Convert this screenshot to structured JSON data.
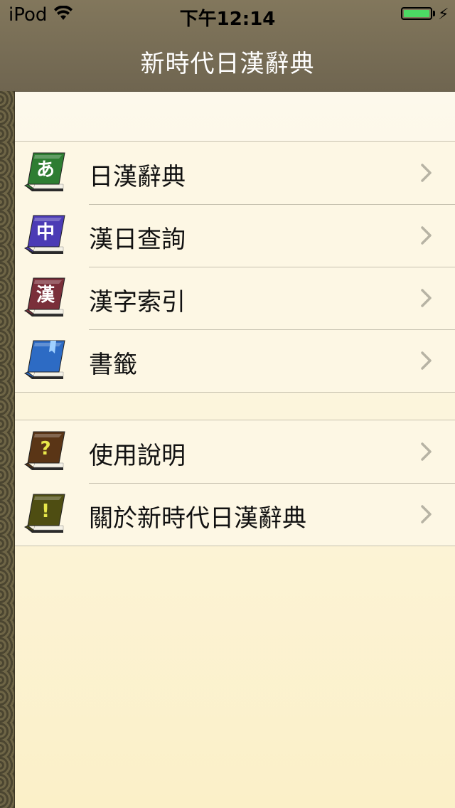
{
  "status_bar": {
    "carrier": "iPod",
    "time": "下午12:14",
    "battery_level": 1.0,
    "charging": true
  },
  "nav": {
    "title": "新時代日漢辭典"
  },
  "menu": {
    "group1": [
      {
        "label": "日漢辭典",
        "icon": "book-hiragana-icon",
        "color": "#2e7d32",
        "glyph": "あ"
      },
      {
        "label": "漢日查詢",
        "icon": "book-chinese-icon",
        "color": "#4b3bb5",
        "glyph": "中"
      },
      {
        "label": "漢字索引",
        "icon": "book-kanji-icon",
        "color": "#7a2f3a",
        "glyph": "漢"
      },
      {
        "label": "書籤",
        "icon": "book-bookmark-icon",
        "color": "#2d6bc4",
        "glyph": ""
      }
    ],
    "group2": [
      {
        "label": "使用說明",
        "icon": "book-help-icon",
        "color": "#5a3516",
        "glyph": "?"
      },
      {
        "label": "關於新時代日漢辭典",
        "icon": "book-info-icon",
        "color": "#4e4d12",
        "glyph": "!"
      }
    ]
  },
  "colors": {
    "navbar": "#786d55",
    "background": "#fdf6dc",
    "separator": "#c7c2b0"
  }
}
